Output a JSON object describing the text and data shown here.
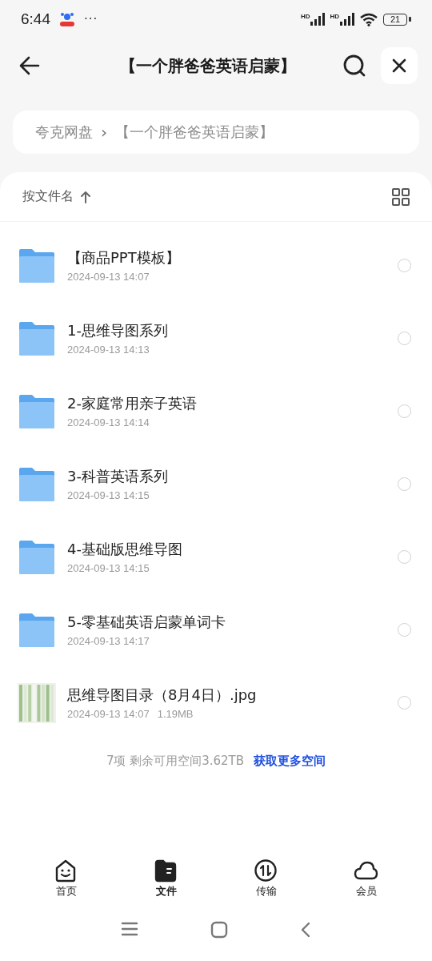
{
  "status_bar": {
    "time": "6:44",
    "more": "···",
    "signal_labels": [
      "HD",
      "HD"
    ],
    "battery": "21"
  },
  "header": {
    "title": "【一个胖爸爸英语启蒙】"
  },
  "breadcrumb": [
    "夸克网盘",
    "【一个胖爸爸英语启蒙】"
  ],
  "breadcrumb_separator": "›",
  "sort": {
    "label": "按文件名"
  },
  "files": [
    {
      "kind": "folder",
      "name": "【商品PPT模板】",
      "date": "2024-09-13 14:07",
      "selected": false
    },
    {
      "kind": "folder",
      "name": "1-思维导图系列",
      "date": "2024-09-13 14:13",
      "selected": false
    },
    {
      "kind": "folder",
      "name": "2-家庭常用亲子英语",
      "date": "2024-09-13 14:14",
      "selected": false
    },
    {
      "kind": "folder",
      "name": "3-科普英语系列",
      "date": "2024-09-13 14:15",
      "selected": false
    },
    {
      "kind": "folder",
      "name": "4-基础版思维导图",
      "date": "2024-09-13 14:15",
      "selected": false
    },
    {
      "kind": "folder",
      "name": "5-零基础英语启蒙单词卡",
      "date": "2024-09-13 14:17",
      "selected": false
    },
    {
      "name": "思维导图目录（8月4日）.jpg",
      "date": "2024-09-13 14:07",
      "size": "1.19MB",
      "selected": false
    }
  ],
  "footer": {
    "summary": "7项 剩余可用空间3.62TB",
    "link": "获取更多空间"
  },
  "tabs": [
    {
      "label": "首页",
      "selected": false
    },
    {
      "label": "文件",
      "selected": true
    },
    {
      "label": "传输",
      "selected": false
    },
    {
      "label": "会员",
      "selected": false
    }
  ]
}
